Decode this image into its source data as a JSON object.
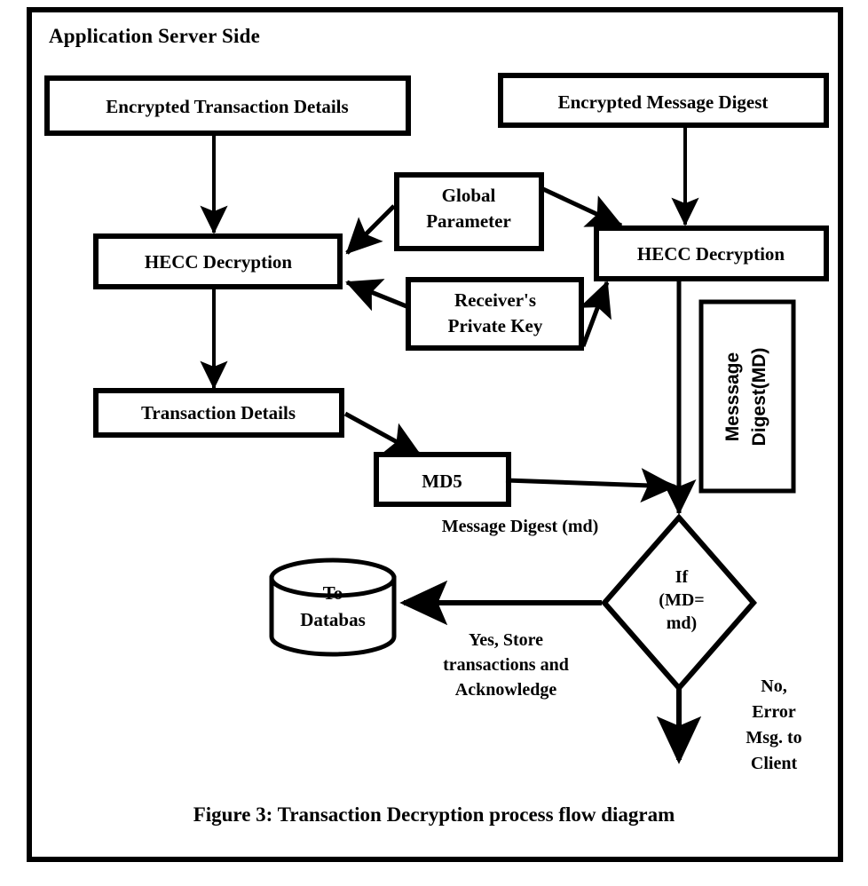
{
  "figure": {
    "frame_label": "Application Server Side",
    "caption": "Figure 3: Transaction Decryption process flow diagram",
    "stroke_color": "#000000",
    "fill_color": "#ffffff"
  },
  "nodes": {
    "encrypted_transaction_details": "Encrypted Transaction Details",
    "encrypted_message_digest": "Encrypted Message Digest",
    "hecc_decryption_left": "HECC Decryption",
    "hecc_decryption_right": "HECC Decryption",
    "global_parameter_line1": "Global",
    "global_parameter_line2": "Parameter",
    "receivers_private_key_line1": "Receiver's",
    "receivers_private_key_line2": "Private Key",
    "transaction_details": "Transaction Details",
    "md5": "MD5",
    "message_digest_md_label": "Message Digest (md)",
    "message_digest_vertical_line1": "Messsage",
    "message_digest_vertical_line2": "Digest(MD)",
    "decision_line1": "If",
    "decision_line2": "(MD=",
    "decision_line3": "md)",
    "database_line1": "To",
    "database_line2": "Databas"
  },
  "edge_labels": {
    "yes_branch_line1": "Yes, Store",
    "yes_branch_line2": "transactions and",
    "yes_branch_line3": "Acknowledge",
    "no_branch_line1": "No,",
    "no_branch_line2": "Error",
    "no_branch_line3": "Msg. to",
    "no_branch_line4": "Client"
  }
}
